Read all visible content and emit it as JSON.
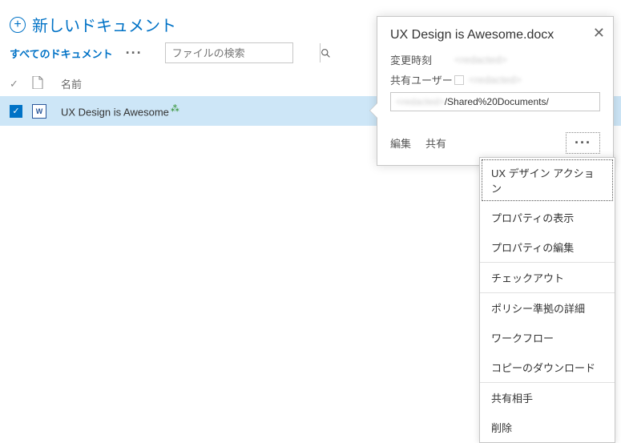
{
  "header": {
    "new_document_label": "新しいドキュメント"
  },
  "toolbar": {
    "all_documents_label": "すべてのドキュメント",
    "search_placeholder": "ファイルの検索"
  },
  "list": {
    "columns": {
      "name": "名前"
    },
    "rows": [
      {
        "name": "UX Design is Awesome",
        "is_new": true,
        "selected": true
      }
    ]
  },
  "callout": {
    "title": "UX Design is Awesome.docx",
    "modified_label": "変更時刻",
    "modified_value": "<redacted>",
    "shared_label": "共有ユーザー",
    "shared_value": "<redacted>",
    "url_prefix": "<redacted>",
    "url_suffix": "/Shared%20Documents/",
    "actions": {
      "edit": "編集",
      "share": "共有"
    }
  },
  "context_menu": {
    "items": [
      "UX デザイン アクション",
      "プロパティの表示",
      "プロパティの編集",
      "チェックアウト",
      "ポリシー準拠の詳細",
      "ワークフロー",
      "コピーのダウンロード",
      "共有相手",
      "削除"
    ]
  }
}
